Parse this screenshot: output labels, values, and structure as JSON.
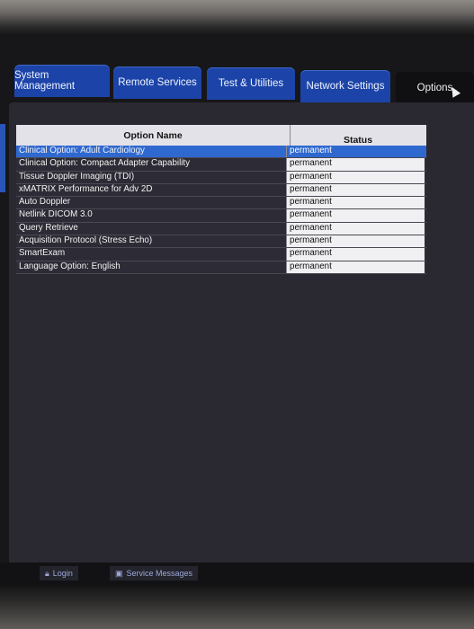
{
  "tabs": [
    {
      "label": "System Management"
    },
    {
      "label": "Remote Services"
    },
    {
      "label": "Test & Utilities"
    },
    {
      "label": "Network Settings"
    },
    {
      "label": "Options"
    }
  ],
  "table": {
    "columns": [
      "Option Name",
      "Status"
    ],
    "rows": [
      {
        "name": "Clinical Option: Adult Cardiology",
        "status": "permanent"
      },
      {
        "name": "Clinical Option: Compact Adapter Capability",
        "status": "permanent"
      },
      {
        "name": "Tissue Doppler Imaging (TDI)",
        "status": "permanent"
      },
      {
        "name": "xMATRIX Performance for Adv 2D",
        "status": "permanent"
      },
      {
        "name": "Auto Doppler",
        "status": "permanent"
      },
      {
        "name": "Netlink DICOM 3.0",
        "status": "permanent"
      },
      {
        "name": "Query Retrieve",
        "status": "permanent"
      },
      {
        "name": "Acquisition Protocol (Stress Echo)",
        "status": "permanent"
      },
      {
        "name": "SmartExam",
        "status": "permanent"
      },
      {
        "name": "Language Option: English",
        "status": "permanent"
      }
    ]
  },
  "bottombar": {
    "login_label": "Login",
    "service_label": "Service Messages"
  },
  "colors": {
    "tab_blue": "#1c44a8",
    "selected_row": "#2f69d0"
  }
}
